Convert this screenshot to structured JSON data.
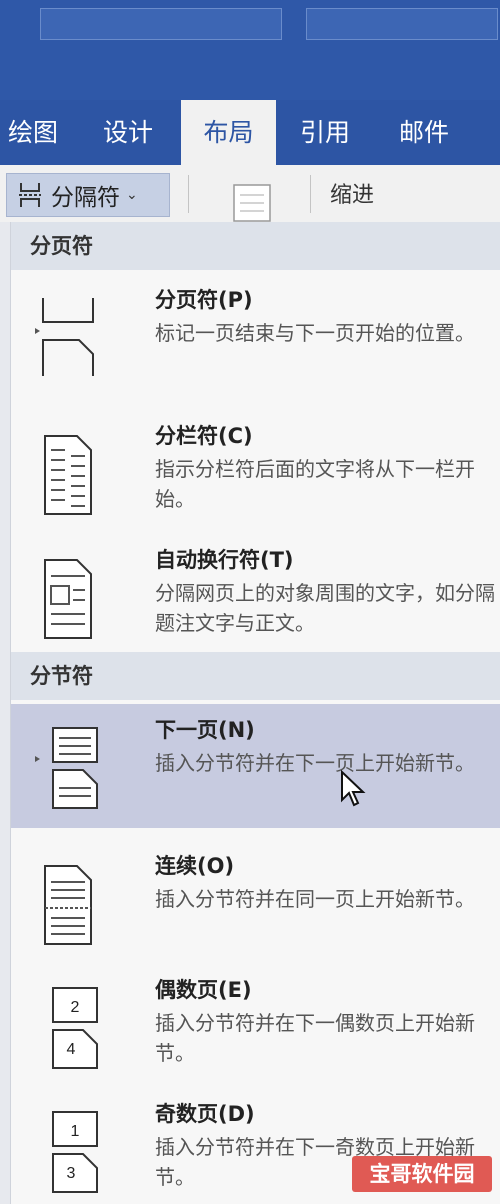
{
  "ribbon": {
    "tabs": [
      {
        "label": "绘图"
      },
      {
        "label": "设计"
      },
      {
        "label": "布局",
        "active": true
      },
      {
        "label": "引用"
      },
      {
        "label": "邮件"
      }
    ]
  },
  "toolbar": {
    "breaks_label": "分隔符",
    "indent_label": "缩进"
  },
  "menu": {
    "page_breaks_header": "分页符",
    "section_breaks_header": "分节符",
    "items": [
      {
        "title": "分页符(P)",
        "desc": "标记一页结束与下一页开始的位置。",
        "icon": "page-break-icon"
      },
      {
        "title": "分栏符(C)",
        "desc": "指示分栏符后面的文字将从下一栏开始。",
        "icon": "column-break-icon"
      },
      {
        "title": "自动换行符(T)",
        "desc": "分隔网页上的对象周围的文字，如分隔题注文字与正文。",
        "icon": "text-wrapping-icon"
      },
      {
        "title": "下一页(N)",
        "desc": "插入分节符并在下一页上开始新节。",
        "icon": "next-page-icon",
        "highlighted": true
      },
      {
        "title": "连续(O)",
        "desc": "插入分节符并在同一页上开始新节。",
        "icon": "continuous-icon"
      },
      {
        "title": "偶数页(E)",
        "desc": "插入分节符并在下一偶数页上开始新节。",
        "icon": "even-page-icon"
      },
      {
        "title": "奇数页(D)",
        "desc": "插入分节符并在下一奇数页上开始新节。",
        "icon": "odd-page-icon"
      }
    ]
  },
  "watermark": "宝哥软件园",
  "colors": {
    "ribbon_blue": "#2d55a4",
    "highlight": "#c7cbe0",
    "section_header_bg": "#dde2ea"
  }
}
